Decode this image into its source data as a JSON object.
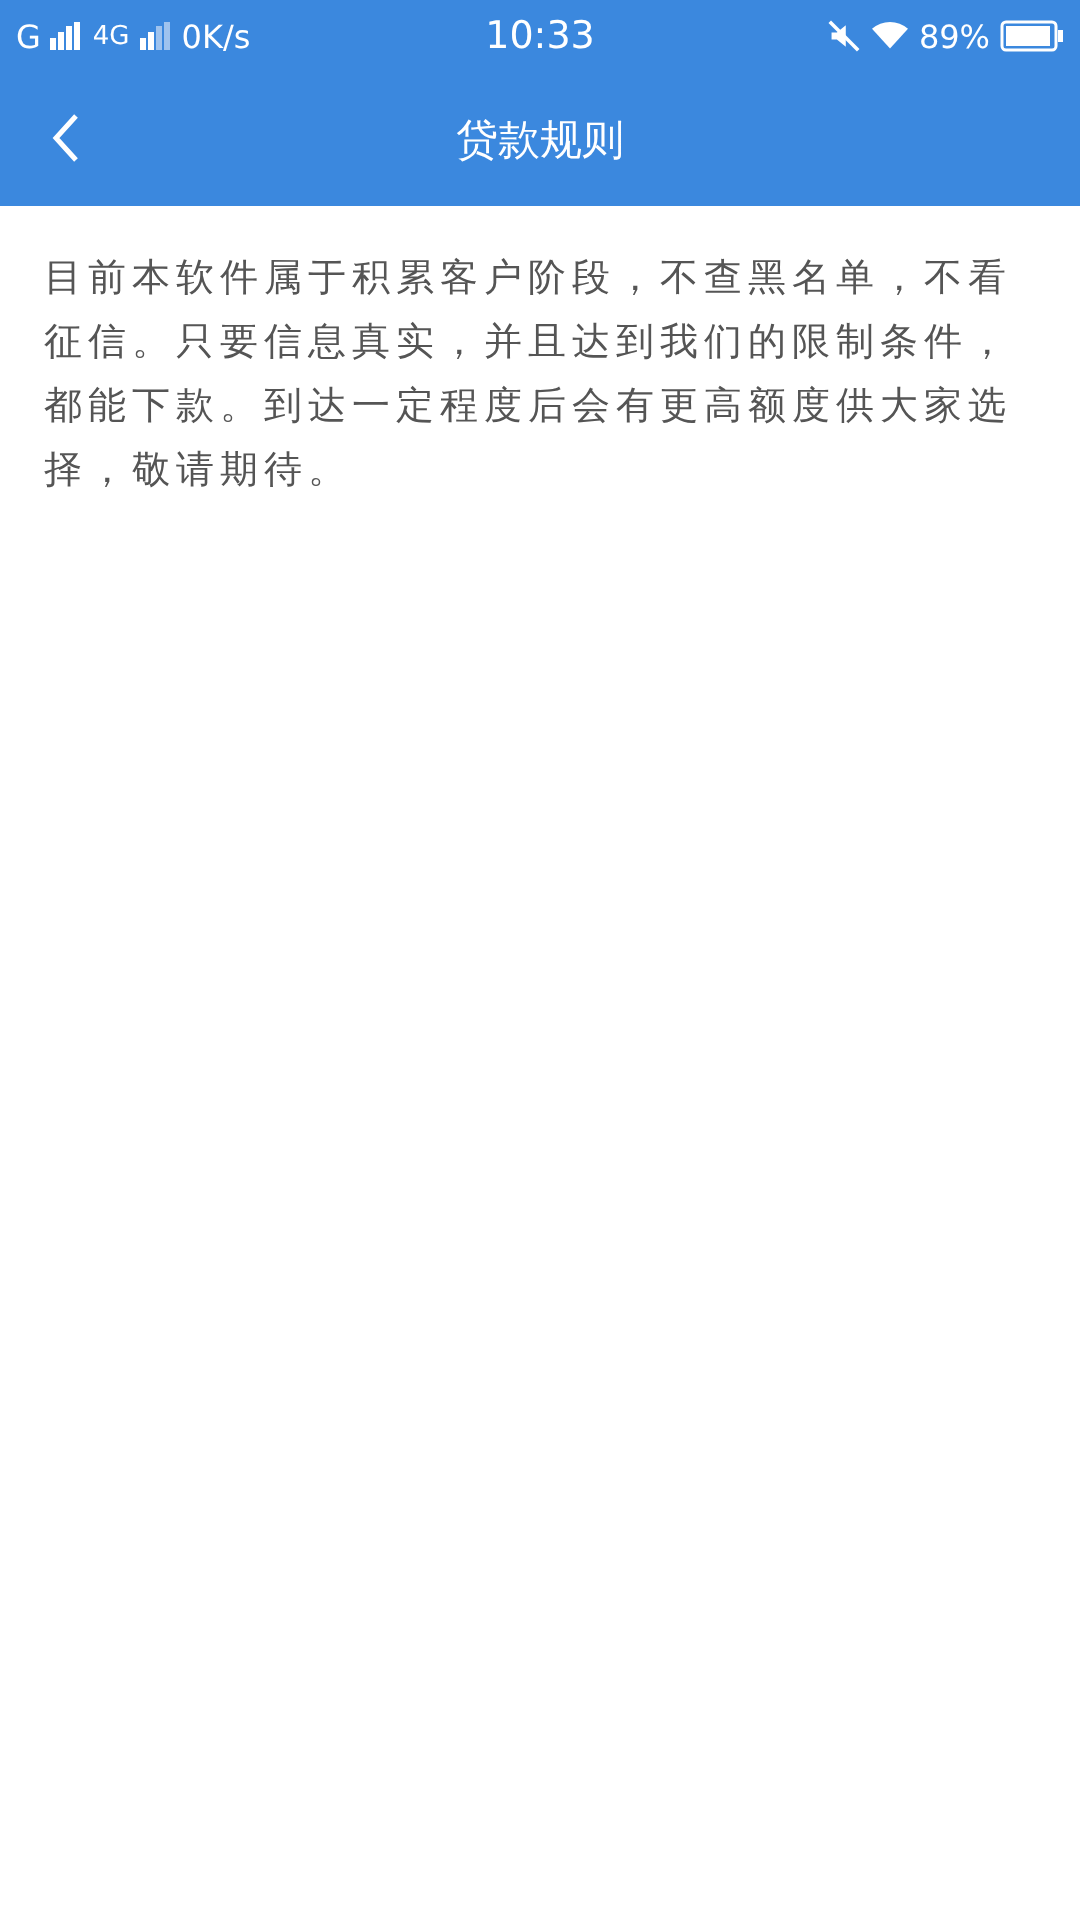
{
  "status_bar": {
    "carrier_1": "G",
    "carrier_2": "4G",
    "speed": "0K/s",
    "time": "10:33",
    "battery": "89%"
  },
  "header": {
    "title": "贷款规则"
  },
  "content": {
    "text": "目前本软件属于积累客户阶段，不查黑名单，不看征信。只要信息真实，并且达到我们的限制条件，都能下款。到达一定程度后会有更高额度供大家选择，敬请期待。"
  }
}
